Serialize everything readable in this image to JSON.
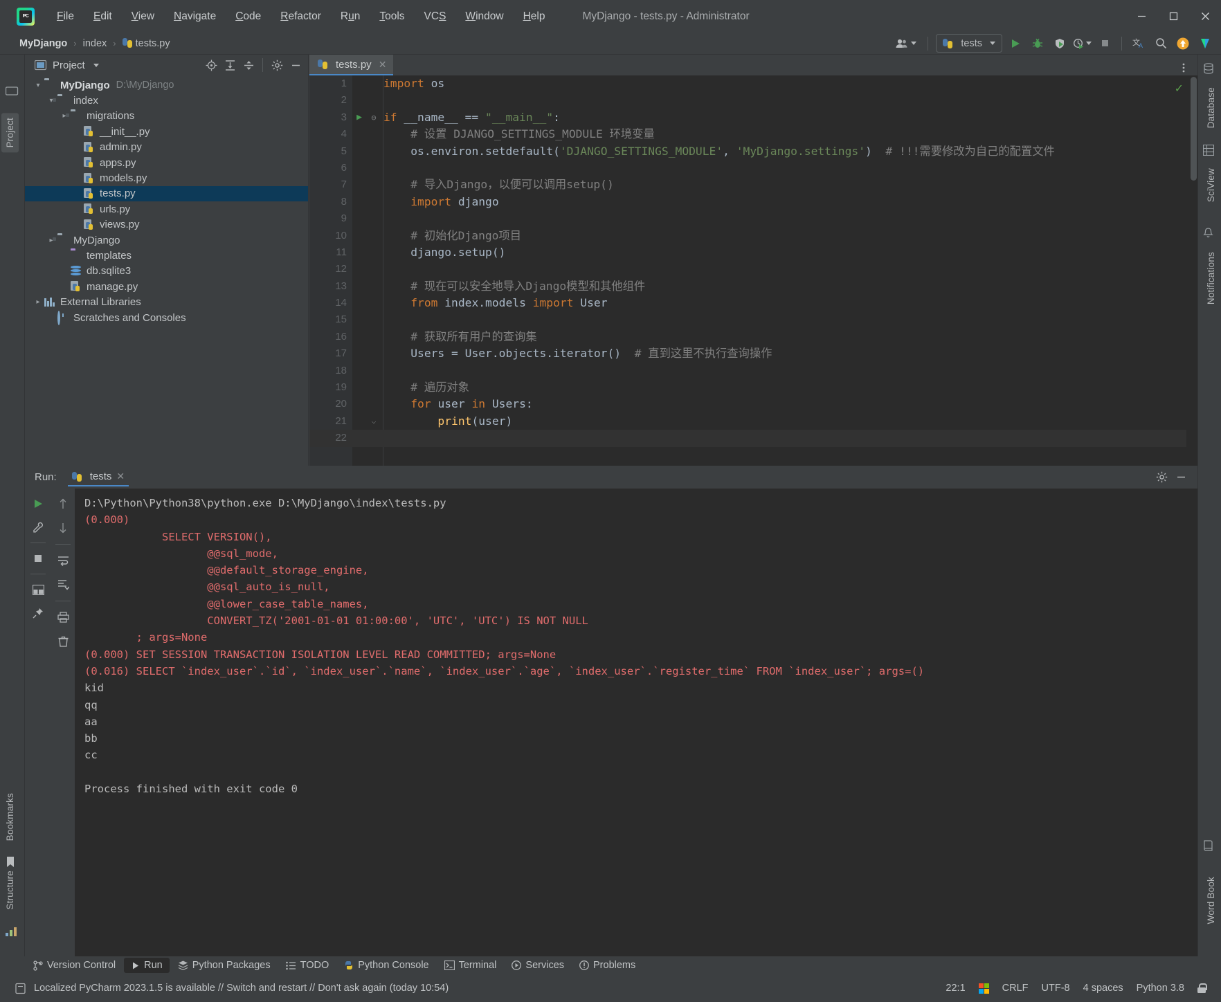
{
  "window": {
    "title": "MyDjango - tests.py - Administrator",
    "minimize_label": "─",
    "maximize_label": "□",
    "close_label": "✕"
  },
  "menubar": {
    "items": [
      {
        "label": "File",
        "accel": "F"
      },
      {
        "label": "Edit",
        "accel": "E"
      },
      {
        "label": "View",
        "accel": "V"
      },
      {
        "label": "Navigate",
        "accel": "N"
      },
      {
        "label": "Code",
        "accel": "C"
      },
      {
        "label": "Refactor",
        "accel": "R"
      },
      {
        "label": "Run",
        "accel": "u"
      },
      {
        "label": "Tools",
        "accel": "T"
      },
      {
        "label": "VCS",
        "accel": "S"
      },
      {
        "label": "Window",
        "accel": "W"
      },
      {
        "label": "Help",
        "accel": "H"
      }
    ]
  },
  "breadcrumb": {
    "items": [
      "MyDjango",
      "index",
      "tests.py"
    ],
    "separator": "›"
  },
  "toolbar": {
    "run_config_name": "tests",
    "icons": [
      "user-icon",
      "run-icon",
      "debug-icon",
      "run-coverage-icon",
      "profile-icon",
      "stop-icon",
      "translate-icon",
      "search-icon",
      "update-icon",
      "ide-feature-icon"
    ]
  },
  "left_strip": {
    "top_tabs": [
      "Project"
    ],
    "bottom_tabs": [
      "Bookmarks",
      "Structure"
    ]
  },
  "right_strip": {
    "tabs": [
      "Database",
      "SciView",
      "Notifications",
      "Word Book"
    ]
  },
  "project_panel": {
    "title": "Project",
    "header_icons": [
      "locate-icon",
      "expand-all-icon",
      "collapse-all-icon",
      "settings-icon",
      "hide-icon"
    ],
    "tree": [
      {
        "label": "MyDjango",
        "path": "D:\\MyDjango",
        "indent": 0,
        "arrow": "open",
        "icon": "folder",
        "bold": true,
        "selected": false
      },
      {
        "label": "index",
        "path": "",
        "indent": 1,
        "arrow": "open",
        "icon": "folder-module",
        "bold": false,
        "selected": false
      },
      {
        "label": "migrations",
        "path": "",
        "indent": 2,
        "arrow": "closed",
        "icon": "folder-module",
        "bold": false,
        "selected": false
      },
      {
        "label": "__init__.py",
        "path": "",
        "indent": 3,
        "arrow": "none",
        "icon": "python-file",
        "bold": false,
        "selected": false
      },
      {
        "label": "admin.py",
        "path": "",
        "indent": 3,
        "arrow": "none",
        "icon": "python-file",
        "bold": false,
        "selected": false
      },
      {
        "label": "apps.py",
        "path": "",
        "indent": 3,
        "arrow": "none",
        "icon": "python-file",
        "bold": false,
        "selected": false
      },
      {
        "label": "models.py",
        "path": "",
        "indent": 3,
        "arrow": "none",
        "icon": "python-file",
        "bold": false,
        "selected": false
      },
      {
        "label": "tests.py",
        "path": "",
        "indent": 3,
        "arrow": "none",
        "icon": "python-file",
        "bold": false,
        "selected": true
      },
      {
        "label": "urls.py",
        "path": "",
        "indent": 3,
        "arrow": "none",
        "icon": "python-file",
        "bold": false,
        "selected": false
      },
      {
        "label": "views.py",
        "path": "",
        "indent": 3,
        "arrow": "none",
        "icon": "python-file",
        "bold": false,
        "selected": false
      },
      {
        "label": "MyDjango",
        "path": "",
        "indent": 1,
        "arrow": "closed",
        "icon": "folder-module",
        "bold": false,
        "selected": false
      },
      {
        "label": "templates",
        "path": "",
        "indent": 2,
        "arrow": "none",
        "icon": "folder-purple",
        "bold": false,
        "selected": false
      },
      {
        "label": "db.sqlite3",
        "path": "",
        "indent": 2,
        "arrow": "none",
        "icon": "database",
        "bold": false,
        "selected": false
      },
      {
        "label": "manage.py",
        "path": "",
        "indent": 2,
        "arrow": "none",
        "icon": "python-file",
        "bold": false,
        "selected": false
      },
      {
        "label": "External Libraries",
        "path": "",
        "indent": 0,
        "arrow": "closed",
        "icon": "library",
        "bold": false,
        "selected": false
      },
      {
        "label": "Scratches and Consoles",
        "path": "",
        "indent": 1,
        "arrow": "none",
        "icon": "scratches",
        "bold": false,
        "selected": false
      }
    ]
  },
  "editor": {
    "tab_label": "tests.py",
    "tab_close": "✕",
    "inspection_ok": "✓",
    "cursor_line": 22,
    "lines": [
      {
        "n": 1,
        "indent": 0,
        "tokens": [
          {
            "t": "import",
            "c": "kw"
          },
          {
            "t": " os",
            "c": "txt"
          }
        ]
      },
      {
        "n": 2,
        "indent": 0,
        "tokens": []
      },
      {
        "n": 3,
        "indent": 0,
        "runmark": true,
        "fold": true,
        "tokens": [
          {
            "t": "if",
            "c": "kw"
          },
          {
            "t": " __name__ == ",
            "c": "txt"
          },
          {
            "t": "\"__main__\"",
            "c": "str"
          },
          {
            "t": ":",
            "c": "txt"
          }
        ]
      },
      {
        "n": 4,
        "indent": 1,
        "tokens": [
          {
            "t": "# 设置 DJANGO_SETTINGS_MODULE 环境变量",
            "c": "cmt"
          }
        ]
      },
      {
        "n": 5,
        "indent": 1,
        "tokens": [
          {
            "t": "os.environ.setdefault(",
            "c": "txt"
          },
          {
            "t": "'DJANGO_SETTINGS_MODULE'",
            "c": "str"
          },
          {
            "t": ", ",
            "c": "txt"
          },
          {
            "t": "'MyDjango.settings'",
            "c": "str"
          },
          {
            "t": ")  ",
            "c": "txt"
          },
          {
            "t": "# !!!需要修改为自己的配置文件",
            "c": "cmt"
          }
        ]
      },
      {
        "n": 6,
        "indent": 1,
        "tokens": []
      },
      {
        "n": 7,
        "indent": 1,
        "tokens": [
          {
            "t": "# 导入Django，以便可以调用setup()",
            "c": "cmt"
          }
        ]
      },
      {
        "n": 8,
        "indent": 1,
        "tokens": [
          {
            "t": "import",
            "c": "kw"
          },
          {
            "t": " django",
            "c": "txt"
          }
        ]
      },
      {
        "n": 9,
        "indent": 1,
        "tokens": []
      },
      {
        "n": 10,
        "indent": 1,
        "tokens": [
          {
            "t": "# 初始化Django项目",
            "c": "cmt"
          }
        ]
      },
      {
        "n": 11,
        "indent": 1,
        "tokens": [
          {
            "t": "django.setup()",
            "c": "txt"
          }
        ]
      },
      {
        "n": 12,
        "indent": 1,
        "tokens": []
      },
      {
        "n": 13,
        "indent": 1,
        "tokens": [
          {
            "t": "# 现在可以安全地导入Django模型和其他组件",
            "c": "cmt"
          }
        ]
      },
      {
        "n": 14,
        "indent": 1,
        "tokens": [
          {
            "t": "from",
            "c": "kw"
          },
          {
            "t": " index.models ",
            "c": "txt"
          },
          {
            "t": "import",
            "c": "kw"
          },
          {
            "t": " User",
            "c": "txt"
          }
        ]
      },
      {
        "n": 15,
        "indent": 1,
        "tokens": []
      },
      {
        "n": 16,
        "indent": 1,
        "tokens": [
          {
            "t": "# 获取所有用户的查询集",
            "c": "cmt"
          }
        ]
      },
      {
        "n": 17,
        "indent": 1,
        "tokens": [
          {
            "t": "Users = User.objects.iterator()  ",
            "c": "txt"
          },
          {
            "t": "# 直到这里不执行查询操作",
            "c": "cmt"
          }
        ]
      },
      {
        "n": 18,
        "indent": 1,
        "tokens": []
      },
      {
        "n": 19,
        "indent": 1,
        "tokens": [
          {
            "t": "# 遍历对象",
            "c": "cmt"
          }
        ]
      },
      {
        "n": 20,
        "indent": 1,
        "tokens": [
          {
            "t": "for",
            "c": "kw"
          },
          {
            "t": " user ",
            "c": "txt"
          },
          {
            "t": "in",
            "c": "kw"
          },
          {
            "t": " Users:",
            "c": "txt"
          }
        ]
      },
      {
        "n": 21,
        "indent": 2,
        "fold2": true,
        "tokens": [
          {
            "t": "print",
            "c": "fn"
          },
          {
            "t": "(user)",
            "c": "txt"
          }
        ]
      },
      {
        "n": 22,
        "indent": 0,
        "current": true,
        "tokens": []
      }
    ]
  },
  "run_panel": {
    "label": "Run:",
    "tab_name": "tests",
    "tab_close": "✕",
    "header_icons": [
      "settings-icon",
      "hide-icon"
    ],
    "side_icons": [
      "rerun-icon",
      "modify-run-icon",
      "stop-icon",
      "layout-icon",
      "pin-icon"
    ],
    "side_icons2": [
      "scroll-up-icon",
      "scroll-down-icon",
      "soft-wrap-icon",
      "scroll-to-end-icon",
      "print-icon",
      "clear-icon"
    ],
    "console": [
      {
        "text": "D:\\Python\\Python38\\python.exe D:\\MyDjango\\index\\tests.py",
        "color": "white"
      },
      {
        "text": "(0.000)",
        "color": "red"
      },
      {
        "text": "            SELECT VERSION(),",
        "color": "red"
      },
      {
        "text": "                   @@sql_mode,",
        "color": "red"
      },
      {
        "text": "                   @@default_storage_engine,",
        "color": "red"
      },
      {
        "text": "                   @@sql_auto_is_null,",
        "color": "red"
      },
      {
        "text": "                   @@lower_case_table_names,",
        "color": "red"
      },
      {
        "text": "                   CONVERT_TZ('2001-01-01 01:00:00', 'UTC', 'UTC') IS NOT NULL",
        "color": "red"
      },
      {
        "text": "        ; args=None",
        "color": "red"
      },
      {
        "text": "(0.000) SET SESSION TRANSACTION ISOLATION LEVEL READ COMMITTED; args=None",
        "color": "red"
      },
      {
        "text": "(0.016) SELECT `index_user`.`id`, `index_user`.`name`, `index_user`.`age`, `index_user`.`register_time` FROM `index_user`; args=()",
        "color": "red"
      },
      {
        "text": "kid",
        "color": "white"
      },
      {
        "text": "qq",
        "color": "white"
      },
      {
        "text": "aa",
        "color": "white"
      },
      {
        "text": "bb",
        "color": "white"
      },
      {
        "text": "cc",
        "color": "white"
      },
      {
        "text": "",
        "color": "white"
      },
      {
        "text": "Process finished with exit code 0",
        "color": "white"
      }
    ]
  },
  "bottom_toolbar": {
    "items": [
      {
        "label": "Version Control",
        "icon": "branch-icon",
        "selected": false
      },
      {
        "label": "Run",
        "icon": "run-icon",
        "selected": true
      },
      {
        "label": "Python Packages",
        "icon": "packages-icon",
        "selected": false
      },
      {
        "label": "TODO",
        "icon": "todo-icon",
        "selected": false
      },
      {
        "label": "Python Console",
        "icon": "python-console-icon",
        "selected": false
      },
      {
        "label": "Terminal",
        "icon": "terminal-icon",
        "selected": false
      },
      {
        "label": "Services",
        "icon": "services-icon",
        "selected": false
      },
      {
        "label": "Problems",
        "icon": "problems-icon",
        "selected": false
      }
    ]
  },
  "statusbar": {
    "notification": "Localized PyCharm 2023.1.5 is available // Switch and restart // Don't ask again (today 10:54)",
    "notification_icon": "message-icon",
    "caret_position": "22:1",
    "os_icon": "windows-icon",
    "line_separator": "CRLF",
    "encoding": "UTF-8",
    "indent": "4 spaces",
    "interpreter": "Python 3.8",
    "lock_icon": "unlocked-icon"
  },
  "colors": {
    "accent_blue": "#4a88c7",
    "selection_blue": "#0d3a58",
    "green_run": "#499c54",
    "console_red": "#e06c6c",
    "editor_bg": "#2b2b2b",
    "chrome_bg": "#3c3f41"
  }
}
